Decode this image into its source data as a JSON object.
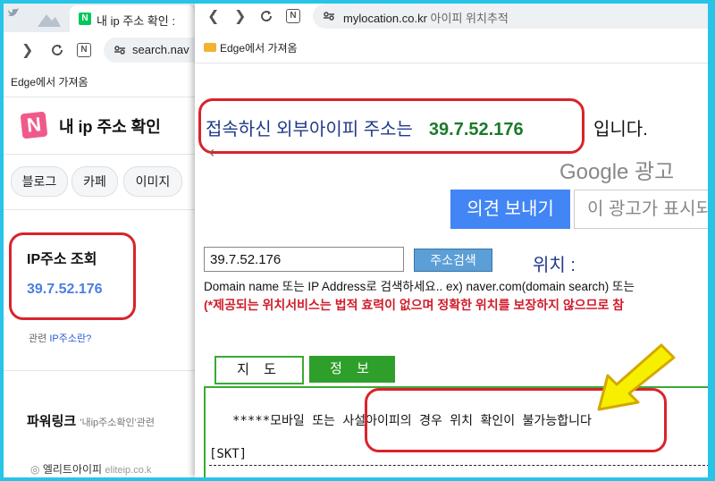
{
  "back_window": {
    "tab_title": "내 ip 주소 확인 :",
    "url": "search.nav",
    "bookmark": "Edge에서 가져옴",
    "page_title": "내 ip 주소 확인",
    "chips": [
      "블로그",
      "카페",
      "이미지"
    ],
    "ip_card_title": "IP주소 조회",
    "ip_card_value": "39.7.52.176",
    "related_prefix": "관련",
    "related_link": "IP주소란?",
    "powerlink": "파워링크",
    "powerlink_sub": "'내ip주소확인'관련",
    "elite_site": "엘리트아이피",
    "elite_url": "eliteip.co.k"
  },
  "front_window": {
    "url_domain": "mylocation.co.kr",
    "url_title": "아이피 위치추적",
    "bookmark": "Edge에서 가져옴",
    "ip_prefix": "접속하신 외부아이피 주소는",
    "ip_value": "39.7.52.176",
    "ip_suffix": "입니다.",
    "google_ads": "Google 광고",
    "feedback_button": "의견 보내기",
    "no_ad_text": "이 광고가 표시되",
    "search_value": "39.7.52.176",
    "search_button": "주소검색",
    "location_label": "위치 :",
    "hint": "Domain name 또는 IP Address로 검색하세요.. ex) naver.com(domain search) 또는",
    "warning": "(*제공되는 위치서비스는 법적 효력이 없으며 정확한 위치를 보장하지 않으므로 참",
    "tab_map": "지 도",
    "tab_info": "정 보",
    "panel_line1": "*****모바일 또는 사설아이피의 경우 위치 확인이 불가능합니다",
    "panel_line2": "[SKT]"
  },
  "colors": {
    "highlight": "#d9232a",
    "ip_green": "#1b7a2a",
    "tab_green": "#2e9f2a",
    "link_blue": "#4a7ee0",
    "arrow_yellow": "#f6f000"
  }
}
